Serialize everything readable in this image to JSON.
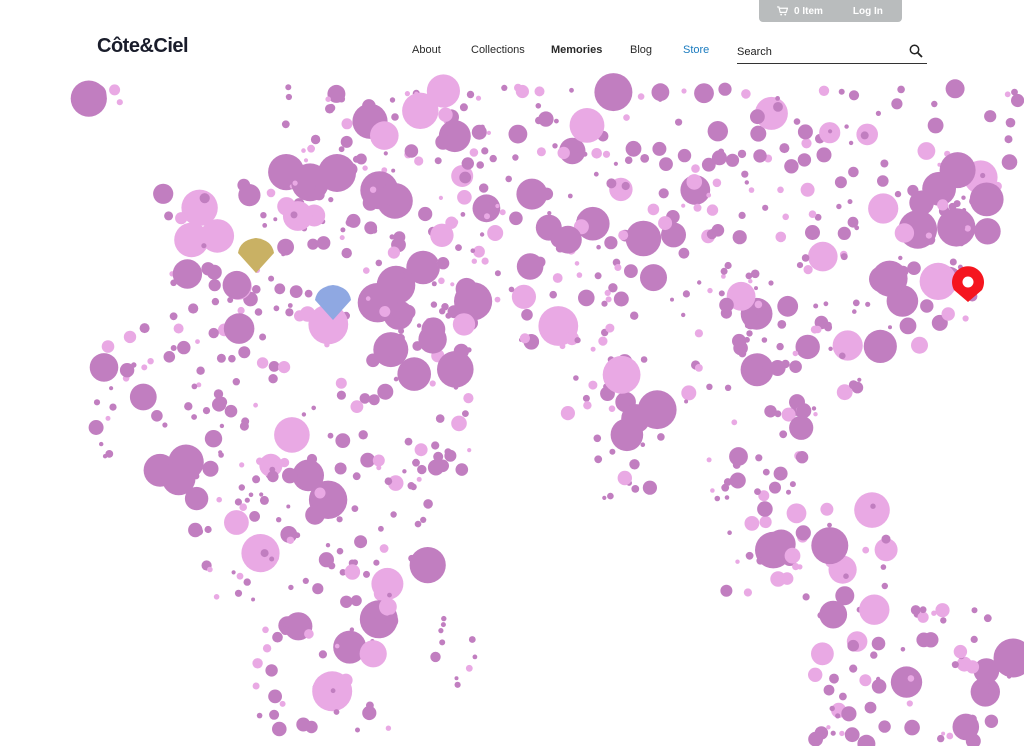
{
  "header": {
    "logo": "Côte&Ciel",
    "cart_label": "0 Item",
    "login_label": "Log In",
    "nav": [
      {
        "label": "About"
      },
      {
        "label": "Collections"
      },
      {
        "label": "Memories"
      },
      {
        "label": "Blog"
      },
      {
        "label": "Store"
      }
    ],
    "search_placeholder": "Search"
  },
  "icons": {
    "cart": "cart-icon",
    "search": "search-icon",
    "markers": [
      "gold-diamond-marker",
      "blue-diamond-marker",
      "red-location-pin-icon"
    ]
  },
  "colors": {
    "dot_dark": "#c17ec0",
    "dot_light": "#e9a9e4",
    "marker_gold": "#c9b164",
    "marker_blue": "#8fa8e2",
    "marker_red": "#f5151f",
    "nav_accent": "#1a7bbf",
    "topbar_bg": "#b9bcbd"
  }
}
